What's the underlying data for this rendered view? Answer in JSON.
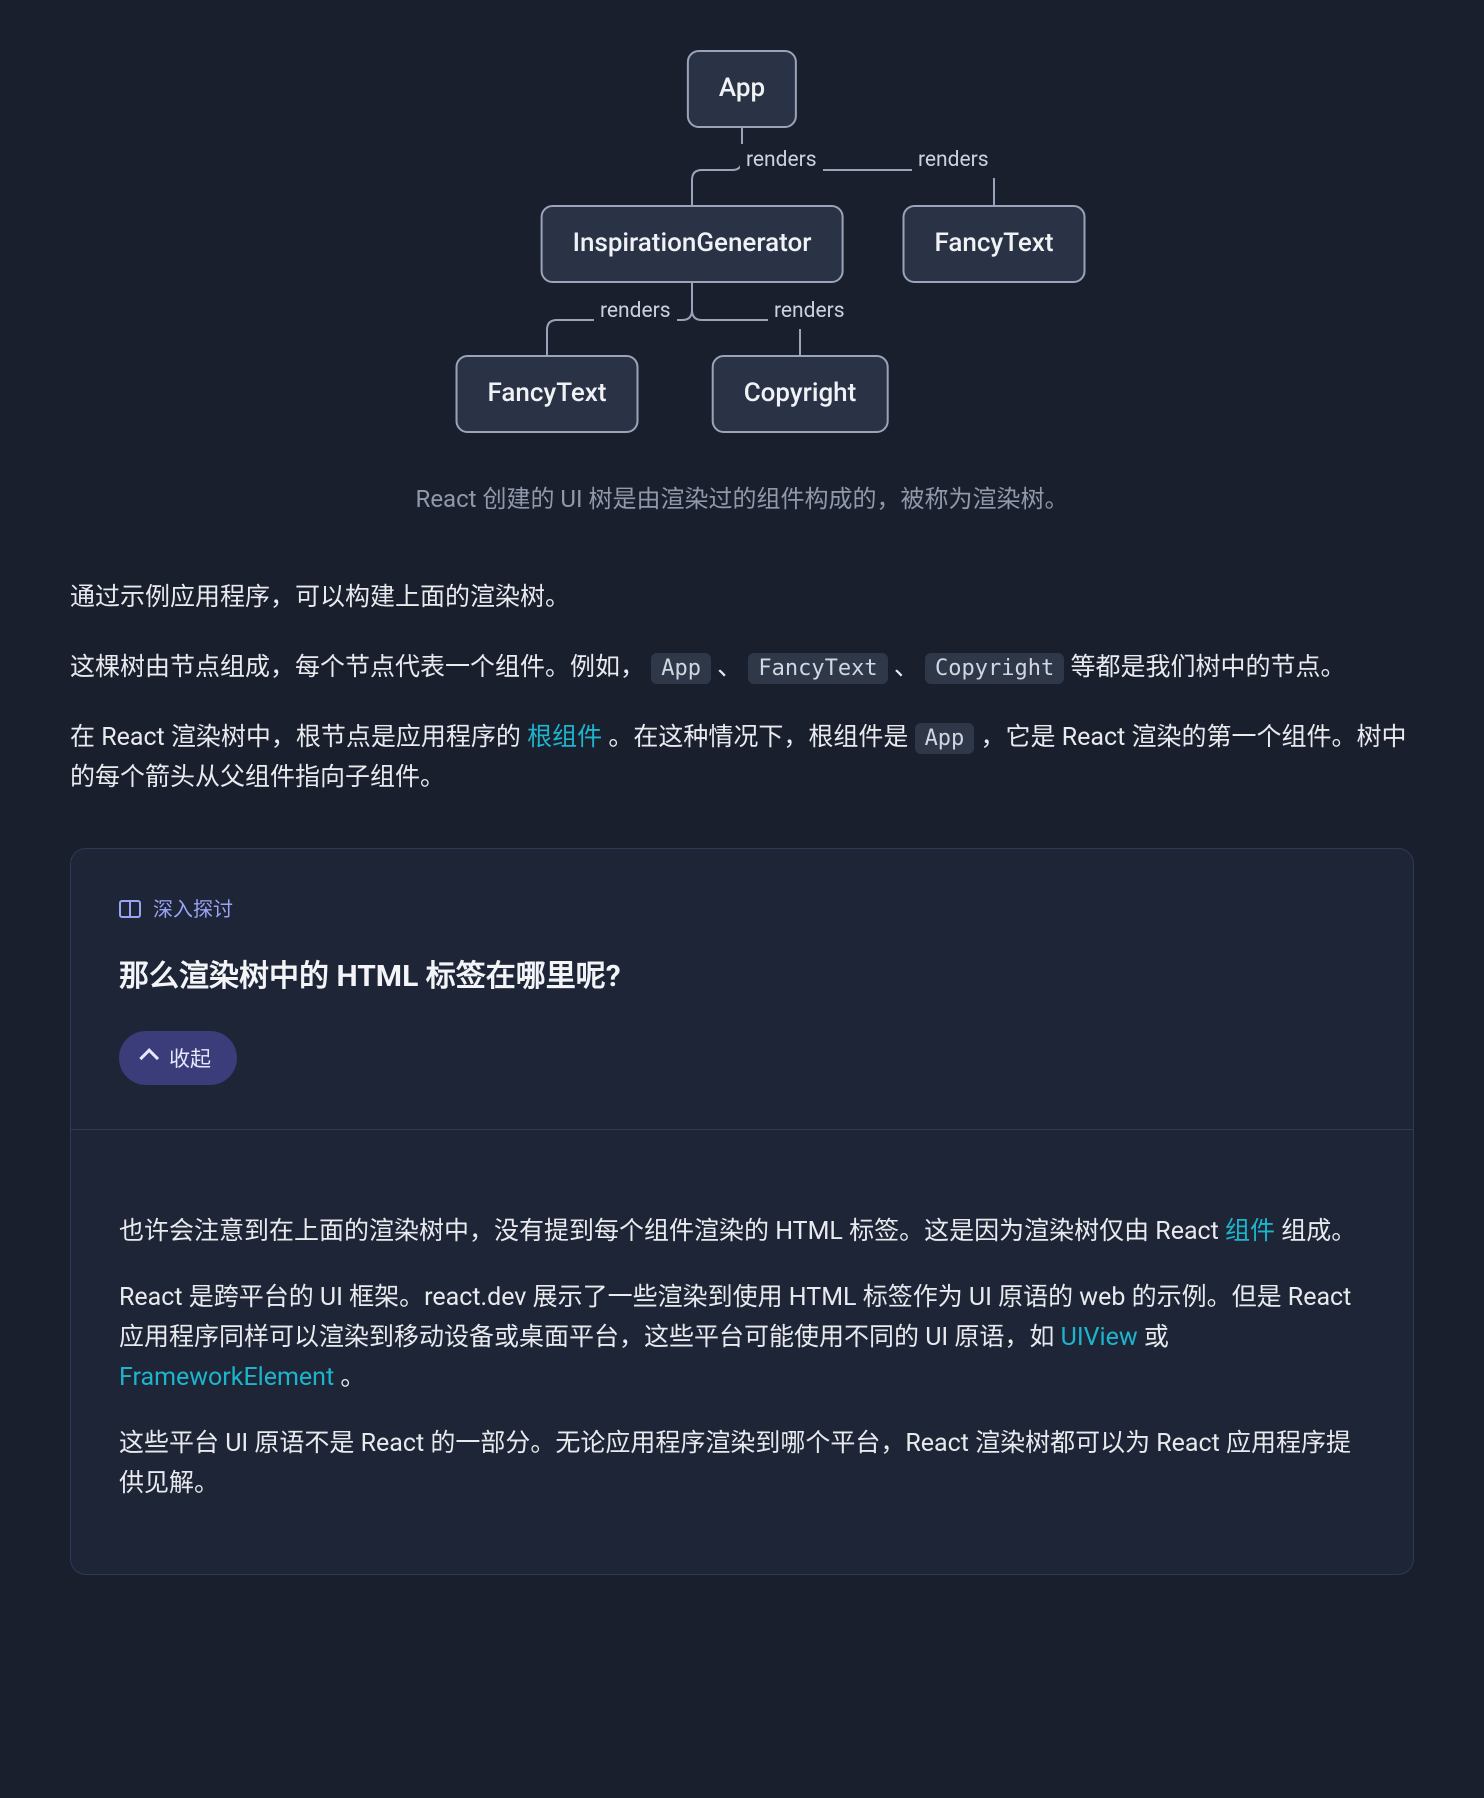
{
  "diagram": {
    "nodes": {
      "app": "App",
      "ig": "InspirationGenerator",
      "ft1": "FancyText",
      "ft2": "FancyText",
      "cr": "Copyright"
    },
    "edge_label": "renders",
    "caption": "React 创建的 UI 树是由渲染过的组件构成的，被称为渲染树。"
  },
  "para1": "通过示例应用程序，可以构建上面的渲染树。",
  "para2": {
    "pre": "这棵树由节点组成，每个节点代表一个组件。例如，",
    "code1": "App",
    "sep1": "、",
    "code2": "FancyText",
    "sep2": "、",
    "code3": "Copyright",
    "post": " 等都是我们树中的节点。"
  },
  "para3": {
    "pre": "在 React 渲染树中，根节点是应用程序的 ",
    "link": "根组件",
    "mid": "。在这种情况下，根组件是 ",
    "code": "App",
    "post": "，它是 React 渲染的第一个组件。树中的每个箭头从父组件指向子组件。"
  },
  "panel": {
    "tag": "深入探讨",
    "title": "那么渲染树中的 HTML 标签在哪里呢?",
    "collapse": "收起",
    "p1": {
      "pre": "也许会注意到在上面的渲染树中，没有提到每个组件渲染的 HTML 标签。这是因为渲染树仅由 React ",
      "link": "组件",
      "post": " 组成。"
    },
    "p2": {
      "pre": "React 是跨平台的 UI 框架。react.dev 展示了一些渲染到使用 HTML 标签作为 UI 原语的 web 的示例。但是 React 应用程序同样可以渲染到移动设备或桌面平台，这些平台可能使用不同的 UI 原语，如 ",
      "link1": "UIView",
      "sep": " 或 ",
      "link2": "FrameworkElement",
      "post": "。"
    },
    "p3": "这些平台 UI 原语不是 React 的一部分。无论应用程序渲染到哪个平台，React 渲染树都可以为 React 应用程序提供见解。"
  }
}
